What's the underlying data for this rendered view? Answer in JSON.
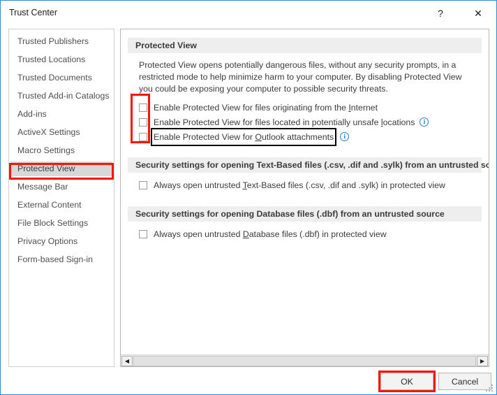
{
  "window": {
    "title": "Trust Center",
    "help_glyph": "?",
    "close_glyph": "✕",
    "border_color": "#2e8ad4"
  },
  "sidebar": {
    "items": [
      {
        "label": "Trusted Publishers",
        "selected": false
      },
      {
        "label": "Trusted Locations",
        "selected": false
      },
      {
        "label": "Trusted Documents",
        "selected": false
      },
      {
        "label": "Trusted Add-in Catalogs",
        "selected": false
      },
      {
        "label": "Add-ins",
        "selected": false
      },
      {
        "label": "ActiveX Settings",
        "selected": false
      },
      {
        "label": "Macro Settings",
        "selected": false
      },
      {
        "label": "Protected View",
        "selected": true
      },
      {
        "label": "Message Bar",
        "selected": false
      },
      {
        "label": "External Content",
        "selected": false
      },
      {
        "label": "File Block Settings",
        "selected": false
      },
      {
        "label": "Privacy Options",
        "selected": false
      },
      {
        "label": "Form-based Sign-in",
        "selected": false
      }
    ]
  },
  "content": {
    "protected_view": {
      "header": "Protected View",
      "description": "Protected View opens potentially dangerous files, without any security prompts, in a restricted mode to help minimize harm to your computer. By disabling Protected View you could be exposing your computer to possible security threats.",
      "options": [
        {
          "label_before": "Enable Protected View for files originating from the ",
          "accelerator": "I",
          "label_after": "nternet",
          "checked": false,
          "has_info_icon": false,
          "focused": false
        },
        {
          "label_before": "Enable Protected View for files located in potentially unsafe ",
          "accelerator": "l",
          "label_after": "ocations",
          "checked": false,
          "has_info_icon": true,
          "focused": false
        },
        {
          "label_before": "Enable Protected View for ",
          "accelerator": "O",
          "label_after": "utlook attachments",
          "checked": false,
          "has_info_icon": true,
          "focused": true
        }
      ]
    },
    "text_based_section": {
      "header": "Security settings for opening Text-Based files (.csv, .dif and .sylk) from an untrusted source",
      "option": {
        "label_before": "Always open untrusted ",
        "accelerator": "T",
        "label_after": "ext-Based files (.csv, .dif and .sylk) in protected view",
        "checked": false
      }
    },
    "database_section": {
      "header": "Security settings for opening Database files (.dbf) from an untrusted source",
      "option": {
        "label_before": "Always open untrusted ",
        "accelerator": "D",
        "label_after": "atabase files (.dbf) in protected view",
        "checked": false
      }
    }
  },
  "scrollbar": {
    "left_arrow_glyph": "◀",
    "right_arrow_glyph": "▶"
  },
  "footer": {
    "ok_label": "OK",
    "cancel_label": "Cancel"
  },
  "annotations": {
    "color": "#fb1500",
    "boxes": [
      {
        "name": "sidebar-protected-view"
      },
      {
        "name": "protected-view-checkbox-column"
      },
      {
        "name": "ok-button"
      }
    ]
  },
  "info_icon_glyph": "i"
}
